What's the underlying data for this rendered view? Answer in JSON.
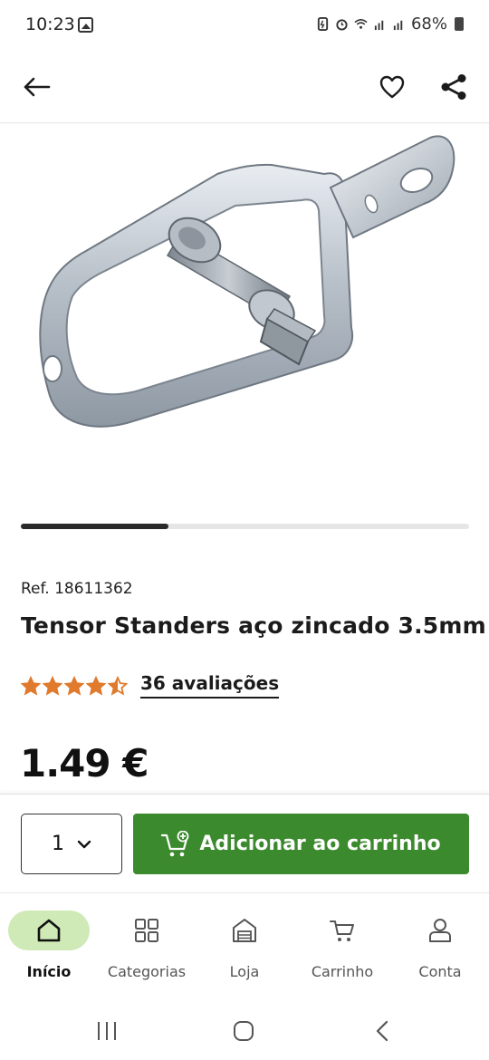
{
  "status_bar": {
    "time": "10:23",
    "battery": "68%"
  },
  "app_bar": {
    "back_icon": "arrow-left-icon",
    "favorite_icon": "heart-icon",
    "share_icon": "share-icon"
  },
  "gallery": {
    "progress_fraction": 0.33,
    "image_subject": "galvanized steel wire tensioner"
  },
  "product": {
    "ref": "Ref. 18611362",
    "title": "Tensor Standers aço zincado 3.5mm",
    "rating_value": 4.5,
    "rating_max": 5,
    "reviews_label": "36 avaliações",
    "price": "1.49 €"
  },
  "purchase": {
    "quantity": "1",
    "add_to_cart_label": "Adicionar ao carrinho"
  },
  "bottom_nav": {
    "items": [
      {
        "label": "Início",
        "icon": "home-icon",
        "active": true
      },
      {
        "label": "Categorias",
        "icon": "grid-icon",
        "active": false
      },
      {
        "label": "Loja",
        "icon": "store-icon",
        "active": false
      },
      {
        "label": "Carrinho",
        "icon": "cart-icon",
        "active": false
      },
      {
        "label": "Conta",
        "icon": "account-icon",
        "active": false
      }
    ]
  },
  "colors": {
    "accent_green": "#3c8a2e",
    "active_nav_bg": "#cfeab6",
    "star_orange": "#e07a2c"
  }
}
